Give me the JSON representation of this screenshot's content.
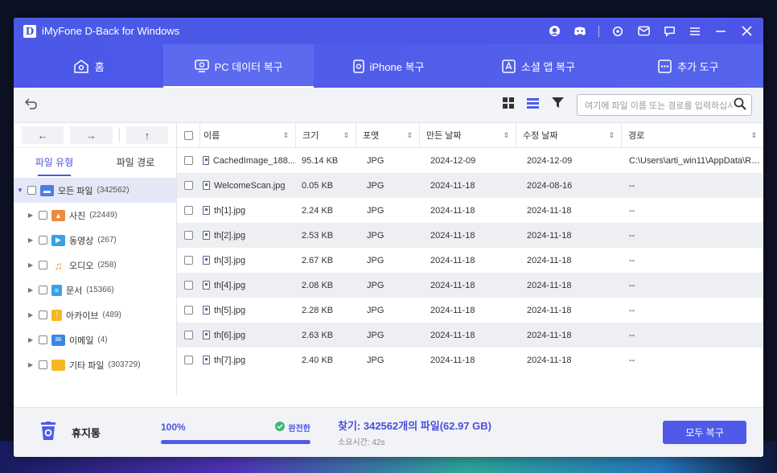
{
  "app": {
    "title": "iMyFone D-Back for Windows",
    "logo_letter": "D"
  },
  "nav": {
    "tabs": [
      {
        "label": "홈"
      },
      {
        "label": "PC 데이터 복구"
      },
      {
        "label": "iPhone 복구"
      },
      {
        "label": "소셜 앱 복구"
      },
      {
        "label": "추가 도구"
      }
    ],
    "active_index": 1
  },
  "toolbar": {
    "search_placeholder": "여기에 파일 이름 또는 경로를 입력하십시오"
  },
  "sidebar": {
    "tabs": [
      "파일 유형",
      "파일 경로"
    ],
    "tree": [
      {
        "label": "모든 파일",
        "count": "(342562)",
        "icon": "drive-icon",
        "color": "#4a7de8"
      },
      {
        "label": "사진",
        "count": "(22449)",
        "icon": "photo-icon",
        "color": "#f08a3c"
      },
      {
        "label": "동영상",
        "count": "(267)",
        "icon": "video-icon",
        "color": "#3aa0e8"
      },
      {
        "label": "오디오",
        "count": "(258)",
        "icon": "music-icon",
        "color": "#f0a030"
      },
      {
        "label": "문서",
        "count": "(15366)",
        "icon": "document-icon",
        "color": "#3aa0e8"
      },
      {
        "label": "아카이브",
        "count": "(489)",
        "icon": "archive-icon",
        "color": "#f5b822"
      },
      {
        "label": "이메일",
        "count": "(4)",
        "icon": "email-icon",
        "color": "#3a86e8"
      },
      {
        "label": "기타 파일",
        "count": "(303729)",
        "icon": "folder-icon",
        "color": "#f5b822"
      }
    ]
  },
  "table": {
    "headers": [
      "이름",
      "크기",
      "포맷",
      "만든 날짜",
      "수정 날짜",
      "경로"
    ],
    "rows": [
      {
        "name": "CachedImage_188...",
        "size": "95.14 KB",
        "format": "JPG",
        "created": "2024-12-09",
        "modified": "2024-12-09",
        "path": "C:\\Users\\arti_win11\\AppData\\Ro..."
      },
      {
        "name": "WelcomeScan.jpg",
        "size": "0.05 KB",
        "format": "JPG",
        "created": "2024-11-18",
        "modified": "2024-08-16",
        "path": "--"
      },
      {
        "name": "th[1].jpg",
        "size": "2.24 KB",
        "format": "JPG",
        "created": "2024-11-18",
        "modified": "2024-11-18",
        "path": "--"
      },
      {
        "name": "th[2].jpg",
        "size": "2.53 KB",
        "format": "JPG",
        "created": "2024-11-18",
        "modified": "2024-11-18",
        "path": "--"
      },
      {
        "name": "th[3].jpg",
        "size": "2.67 KB",
        "format": "JPG",
        "created": "2024-11-18",
        "modified": "2024-11-18",
        "path": "--"
      },
      {
        "name": "th[4].jpg",
        "size": "2.08 KB",
        "format": "JPG",
        "created": "2024-11-18",
        "modified": "2024-11-18",
        "path": "--"
      },
      {
        "name": "th[5].jpg",
        "size": "2.28 KB",
        "format": "JPG",
        "created": "2024-11-18",
        "modified": "2024-11-18",
        "path": "--"
      },
      {
        "name": "th[6].jpg",
        "size": "2.63 KB",
        "format": "JPG",
        "created": "2024-11-18",
        "modified": "2024-11-18",
        "path": "--"
      },
      {
        "name": "th[7].jpg",
        "size": "2.40 KB",
        "format": "JPG",
        "created": "2024-11-18",
        "modified": "2024-11-18",
        "path": "--"
      }
    ]
  },
  "footer": {
    "trash_label": "휴지통",
    "progress_text": "100%",
    "progress_value": 1.0,
    "status": "완전한",
    "found": "찾기: 342562개의 파일(62.97 GB)",
    "elapsed": "소요시간: 42s",
    "recover_all": "모두 복구"
  },
  "colors": {
    "accent": "#4f5be8",
    "titlebar": "#4a5ae6"
  }
}
